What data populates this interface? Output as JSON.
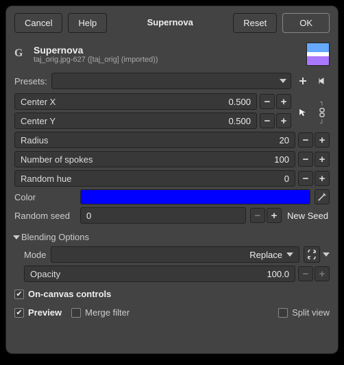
{
  "buttons": {
    "cancel": "Cancel",
    "help": "Help",
    "title": "Supernova",
    "reset": "Reset",
    "ok": "OK"
  },
  "header": {
    "title": "Supernova",
    "subtitle": "taj_orig.jpg-627 ([taj_orig] (imported))"
  },
  "presets": {
    "label": "Presets:"
  },
  "params": {
    "centerx": {
      "label": "Center X",
      "value": "0.500"
    },
    "centery": {
      "label": "Center Y",
      "value": "0.500"
    },
    "radius": {
      "label": "Radius",
      "value": "20"
    },
    "spokes": {
      "label": "Number of spokes",
      "value": "100"
    },
    "randhue": {
      "label": "Random hue",
      "value": "0"
    }
  },
  "color": {
    "label": "Color",
    "hex": "#0000ff"
  },
  "seed": {
    "label": "Random seed",
    "value": "0",
    "newseed": "New Seed"
  },
  "blend": {
    "title": "Blending Options",
    "mode_label": "Mode",
    "mode_value": "Replace",
    "opacity_label": "Opacity",
    "opacity_value": "100.0"
  },
  "checks": {
    "oncanvas": "On-canvas controls",
    "preview": "Preview",
    "merge": "Merge filter",
    "split": "Split view"
  }
}
